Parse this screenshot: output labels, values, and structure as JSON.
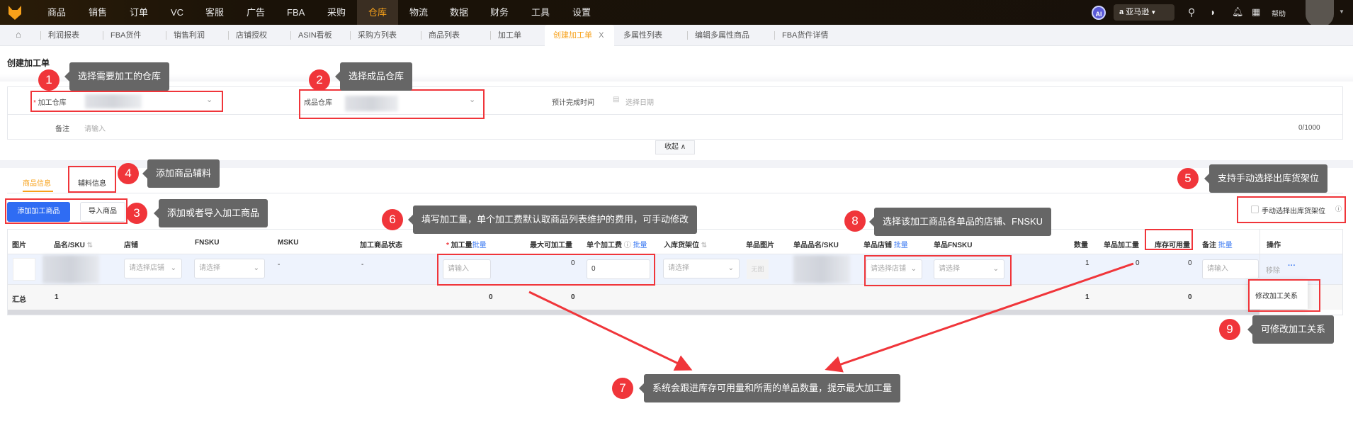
{
  "topnav": {
    "items": [
      "商品",
      "销售",
      "订单",
      "VC",
      "客服",
      "广告",
      "FBA",
      "采购",
      "仓库",
      "物流",
      "数据",
      "财务",
      "工具",
      "设置"
    ],
    "active": "仓库",
    "ai": "AI",
    "marketplace": "亚马逊",
    "help": "帮助"
  },
  "tabs": {
    "items": [
      "利润报表",
      "FBA货件",
      "销售利润",
      "店铺授权",
      "ASIN看板",
      "采购方列表",
      "商品列表",
      "加工单",
      "创建加工单",
      "多属性列表",
      "编辑多属性商品",
      "FBA货件详情"
    ],
    "close": "X"
  },
  "page": {
    "title": "创建加工单"
  },
  "form": {
    "process_warehouse_label": "加工仓库",
    "finished_warehouse_label": "成品仓库",
    "eta_label": "预计完成时间",
    "eta_placeholder": "选择日期",
    "remark_label": "备注",
    "remark_placeholder": "请输入",
    "counter": "0/1000",
    "collapse": "收起"
  },
  "section_tabs": [
    "商品信息",
    "辅料信息"
  ],
  "buttons": {
    "add": "添加加工商品",
    "import": "导入商品"
  },
  "manual_shelf": "手动选择出库货架位",
  "table": {
    "headers": [
      "图片",
      "品名/SKU",
      "店铺",
      "FNSKU",
      "MSKU",
      "加工商品状态",
      "加工量",
      "最大可加工量",
      "单个加工费",
      "入库货架位",
      "单品图片",
      "单品品名/SKU",
      "单品店铺",
      "单品FNSKU",
      "数量",
      "单品加工量",
      "库存可用量",
      "备注",
      "操作"
    ],
    "batch": "批量",
    "row": {
      "shop_ph": "请选择店铺",
      "fnsku_ph": "请选择",
      "msku": "-",
      "status": "-",
      "qty_ph": "请输入",
      "max_qty": "0",
      "unit_fee": "0",
      "shelf_ph": "请选择",
      "no_image": "无图",
      "item_shop_ph": "请选择店铺",
      "item_fnsku_ph": "请选择",
      "count": "1",
      "item_qty": "0",
      "stock": "0",
      "remark_ph": "请输入",
      "remove": "移除",
      "more": "···"
    },
    "summary": {
      "label": "汇总",
      "sku_count": "1",
      "qty": "0",
      "max_qty": "0",
      "count": "1",
      "stock": "0"
    },
    "menu_item": "修改加工关系"
  },
  "annotations": {
    "n1": "1",
    "t1": "选择需要加工的仓库",
    "n2": "2",
    "t2": "选择成品仓库",
    "n3": "3",
    "t3": "添加或者导入加工商品",
    "n4": "4",
    "t4": "添加商品辅料",
    "n5": "5",
    "t5": "支持手动选择出库货架位",
    "n6": "6",
    "t6": "填写加工量，单个加工费默认取商品列表维护的费用，可手动修改",
    "n7": "7",
    "t7": "系统会跟进库存可用量和所需的单品数量，提示最大加工量",
    "n8": "8",
    "t8": "选择该加工商品各单品的店铺、FNSKU",
    "n9": "9",
    "t9": "可修改加工关系"
  }
}
